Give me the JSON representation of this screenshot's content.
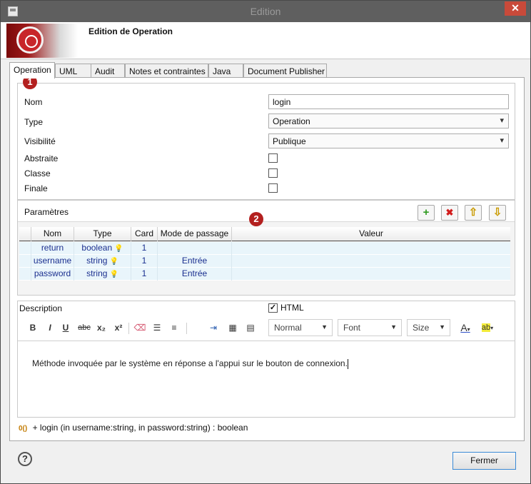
{
  "window": {
    "title": "Edition",
    "close_glyph": "✕",
    "heading": "Edition de Operation"
  },
  "tabs": [
    {
      "label": "Operation",
      "active": true
    },
    {
      "label": "UML"
    },
    {
      "label": "Audit"
    },
    {
      "label": "Notes et contraintes"
    },
    {
      "label": "Java"
    },
    {
      "label": "Document Publisher"
    }
  ],
  "badges": {
    "one": "1",
    "two": "2"
  },
  "properties": {
    "name_label": "Nom",
    "name_value": "login",
    "type_label": "Type",
    "type_value": "Operation",
    "visibility_label": "Visibilité",
    "visibility_value": "Publique",
    "abstract_label": "Abstraite",
    "class_label": "Classe",
    "final_label": "Finale"
  },
  "parameters": {
    "title": "Paramètres",
    "buttons": {
      "add": "+",
      "delete": "✖",
      "up": "⇧",
      "down": "⇩"
    },
    "columns": [
      "Nom",
      "Type",
      "Card",
      "Mode de passage",
      "Valeur"
    ],
    "rows": [
      {
        "name": "return",
        "type": "boolean",
        "card": "1",
        "mode": "",
        "value": ""
      },
      {
        "name": "username",
        "type": "string",
        "card": "1",
        "mode": "Entrée",
        "value": ""
      },
      {
        "name": "password",
        "type": "string",
        "card": "1",
        "mode": "Entrée",
        "value": ""
      }
    ]
  },
  "description": {
    "title": "Description",
    "html_label": "HTML",
    "html_checked": true,
    "toolbar": {
      "bold": "B",
      "italic": "I",
      "underline": "U",
      "strike": "abc",
      "subscript": "x₂",
      "superscript": "x²",
      "format_value": "Normal",
      "font_value": "Font",
      "size_value": "Size",
      "text_color": "A",
      "highlight": "ab"
    },
    "text": "Méthode invoquée par le système en réponse a l'appui sur le bouton de connexion."
  },
  "signature": {
    "icon": "0()",
    "text": "+ login (in username:string, in password:string) : boolean"
  },
  "footer": {
    "help": "?",
    "close_label": "Fermer"
  }
}
